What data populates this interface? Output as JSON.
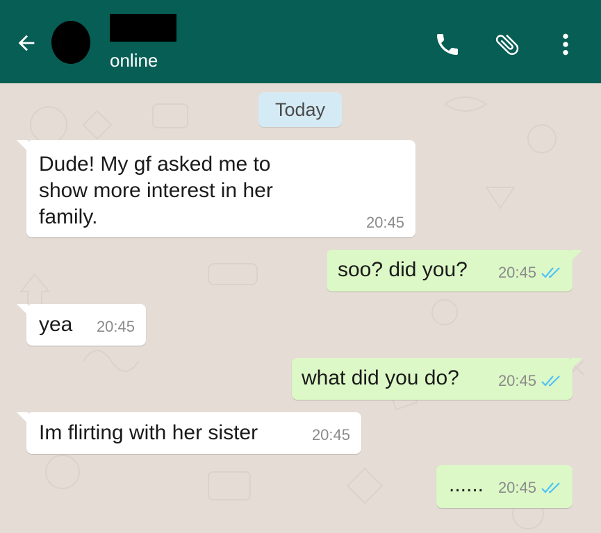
{
  "header": {
    "status": "online",
    "background": "#075e54",
    "back_icon": "arrow-left-icon",
    "call_icon": "phone-icon",
    "attach_icon": "paperclip-icon",
    "menu_icon": "more-vert-icon"
  },
  "chat": {
    "date_label": "Today",
    "messages": [
      {
        "direction": "in",
        "text": "Dude! My gf asked me to show more interest in her family.",
        "time": "20:45"
      },
      {
        "direction": "out",
        "text": "soo? did you?",
        "time": "20:45",
        "status": "read"
      },
      {
        "direction": "in",
        "text": "yea",
        "time": "20:45"
      },
      {
        "direction": "out",
        "text": "what did you do?",
        "time": "20:45",
        "status": "read"
      },
      {
        "direction": "in",
        "text": "Im flirting with her sister",
        "time": "20:45"
      },
      {
        "direction": "out",
        "text": "......",
        "time": "20:45",
        "status": "read"
      }
    ]
  },
  "colors": {
    "incoming": "#ffffff",
    "outgoing": "#dcf8c6",
    "read_tick": "#4fc3f7",
    "wallpaper": "#e5ddd5"
  }
}
